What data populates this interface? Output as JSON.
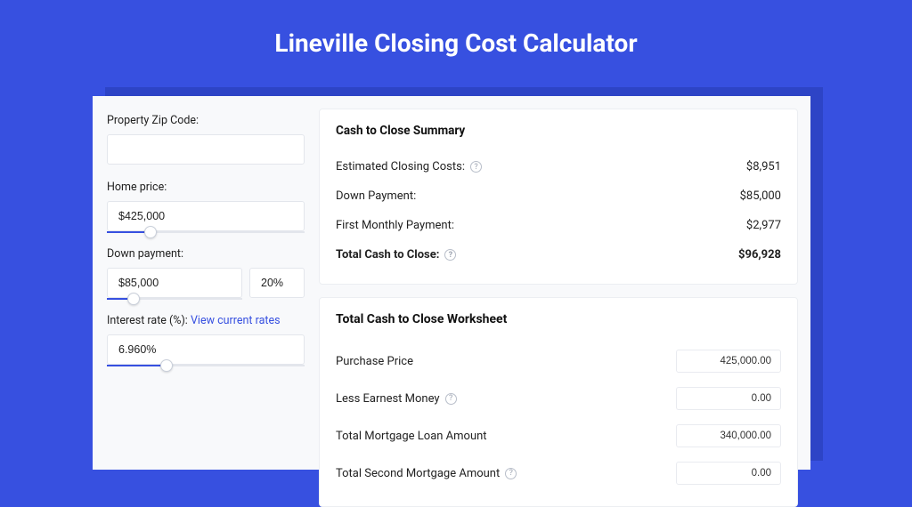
{
  "page": {
    "title": "Lineville Closing Cost Calculator"
  },
  "form": {
    "zip_label": "Property Zip Code:",
    "zip_value": "",
    "price_label": "Home price:",
    "price_value": "$425,000",
    "price_slider_pct": 22,
    "dp_label": "Down payment:",
    "dp_value": "$85,000",
    "dp_pct_value": "20%",
    "dp_slider_pct": 20,
    "rate_label": "Interest rate (%):",
    "rate_link": "View current rates",
    "rate_value": "6.960%",
    "rate_slider_pct": 30
  },
  "summary": {
    "title": "Cash to Close Summary",
    "rows": [
      {
        "label": "Estimated Closing Costs:",
        "help": true,
        "value": "$8,951"
      },
      {
        "label": "Down Payment:",
        "help": false,
        "value": "$85,000"
      },
      {
        "label": "First Monthly Payment:",
        "help": false,
        "value": "$2,977"
      }
    ],
    "total_label": "Total Cash to Close:",
    "total_value": "$96,928"
  },
  "worksheet": {
    "title": "Total Cash to Close Worksheet",
    "rows": [
      {
        "label": "Purchase Price",
        "help": false,
        "value": "425,000.00"
      },
      {
        "label": "Less Earnest Money",
        "help": true,
        "value": "0.00"
      },
      {
        "label": "Total Mortgage Loan Amount",
        "help": false,
        "value": "340,000.00"
      },
      {
        "label": "Total Second Mortgage Amount",
        "help": true,
        "value": "0.00"
      }
    ]
  }
}
